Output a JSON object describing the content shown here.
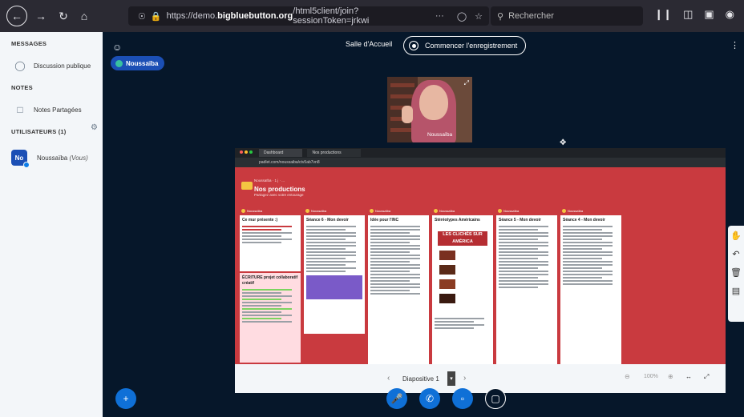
{
  "browser": {
    "url_prefix": "https://demo.",
    "url_host": "bigbluebutton.org",
    "url_path": "/html5client/join?sessionToken=jrkwi",
    "url_more": "···",
    "search_placeholder": "Rechercher"
  },
  "sidebar": {
    "messages_heading": "MESSAGES",
    "public_chat": "Discussion publique",
    "notes_heading": "NOTES",
    "shared_notes": "Notes Partagées",
    "users_heading": "UTILISATEURS (1)",
    "user_initials": "No",
    "user_name": "Noussaïba",
    "user_suffix": "(Vous)"
  },
  "main": {
    "user_chip": "Noussaïba",
    "room_title": "Salle d'Accueil",
    "record_label": "Commencer l'enregistrement",
    "webcam_name": "Noussaïba"
  },
  "presentation": {
    "inner_tab_1": "Dashboard",
    "inner_tab_2": "Nos productions",
    "inner_url": "padlet.com/noussaiba/ctv5ab7vn8",
    "padlet_crumb": "Noussaïba · 1 j · ...",
    "padlet_title": "Nos productions",
    "padlet_sub": "Partagez avec votre entourage",
    "columns": [
      {
        "author": "Noussaïba",
        "title": "Ce mur présente :)"
      },
      {
        "author": "Noussaïba",
        "title": "Séance 6 - Mon devoir"
      },
      {
        "author": "Noussaïba",
        "title": "Idée pour l'INC"
      },
      {
        "author": "Noussaïba",
        "title": "Stéréotypes Américains"
      },
      {
        "author": "Noussaïba",
        "title": "Séance 5 - Mon devoir"
      },
      {
        "author": "Noussaïba",
        "title": "Séance 4 - Mon devoir"
      }
    ],
    "cliches_banner": "LES CLICHÉS SUR AMÉRICA",
    "second_card_title": "ÉCRITURE projet collaboratif créatif",
    "slide_label": "Diapositive 1",
    "zoom": "100%"
  },
  "colors": {
    "bbb_dark": "#06172a",
    "bbb_blue": "#0f70d7",
    "padlet_red": "#c93a3f",
    "sidebar_bg": "#f3f6f9"
  }
}
